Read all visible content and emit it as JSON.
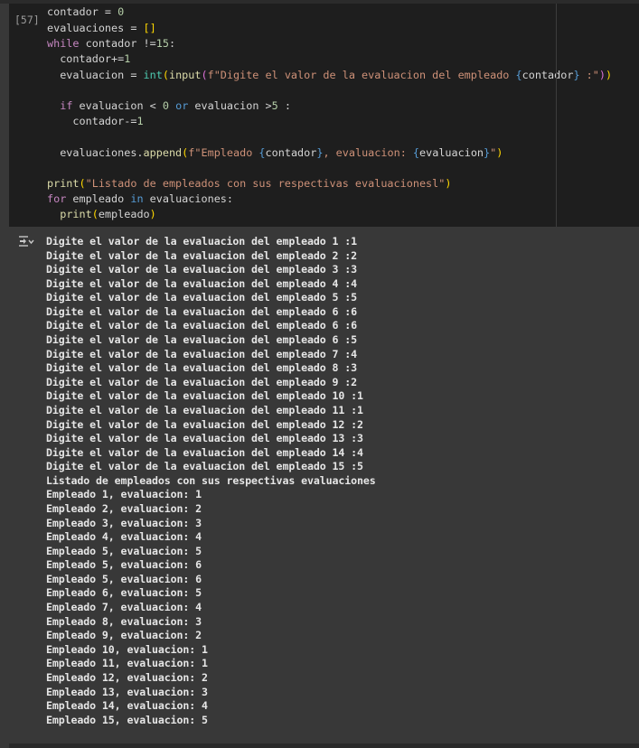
{
  "cell": {
    "execution_count": "[57]",
    "code_lines": [
      [
        {
          "t": "contador = ",
          "c": "txt"
        },
        {
          "t": "0",
          "c": "num"
        }
      ],
      [
        {
          "t": "evaluaciones = ",
          "c": "txt"
        },
        {
          "t": "[]",
          "c": "br"
        }
      ],
      [
        {
          "t": "while",
          "c": "kw"
        },
        {
          "t": " contador !=",
          "c": "txt"
        },
        {
          "t": "15",
          "c": "num"
        },
        {
          "t": ":",
          "c": "txt"
        }
      ],
      [
        {
          "t": "  contador+=",
          "c": "txt"
        },
        {
          "t": "1",
          "c": "num"
        }
      ],
      [
        {
          "t": "  evaluacion = ",
          "c": "txt"
        },
        {
          "t": "int",
          "c": "bi"
        },
        {
          "t": "(",
          "c": "br"
        },
        {
          "t": "input",
          "c": "fn"
        },
        {
          "t": "(",
          "c": "br2"
        },
        {
          "t": "f\"Digite el valor de la evaluacion del empleado ",
          "c": "str"
        },
        {
          "t": "{",
          "c": "ctl"
        },
        {
          "t": "contador",
          "c": "txt"
        },
        {
          "t": "}",
          "c": "ctl"
        },
        {
          "t": " :\"",
          "c": "str"
        },
        {
          "t": ")",
          "c": "br2"
        },
        {
          "t": ")",
          "c": "br"
        }
      ],
      [],
      [
        {
          "t": "  ",
          "c": "txt"
        },
        {
          "t": "if",
          "c": "kw"
        },
        {
          "t": " evaluacion < ",
          "c": "txt"
        },
        {
          "t": "0",
          "c": "num"
        },
        {
          "t": " ",
          "c": "txt"
        },
        {
          "t": "or",
          "c": "ctl"
        },
        {
          "t": " evaluacion >",
          "c": "txt"
        },
        {
          "t": "5",
          "c": "num"
        },
        {
          "t": " :",
          "c": "txt"
        }
      ],
      [
        {
          "t": "    contador-=",
          "c": "txt"
        },
        {
          "t": "1",
          "c": "num"
        }
      ],
      [],
      [
        {
          "t": "  evaluaciones.",
          "c": "txt"
        },
        {
          "t": "append",
          "c": "fn"
        },
        {
          "t": "(",
          "c": "br"
        },
        {
          "t": "f\"Empleado ",
          "c": "str"
        },
        {
          "t": "{",
          "c": "ctl"
        },
        {
          "t": "contador",
          "c": "txt"
        },
        {
          "t": "}",
          "c": "ctl"
        },
        {
          "t": ", evaluacion: ",
          "c": "str"
        },
        {
          "t": "{",
          "c": "ctl"
        },
        {
          "t": "evaluacion",
          "c": "txt"
        },
        {
          "t": "}",
          "c": "ctl"
        },
        {
          "t": "\"",
          "c": "str"
        },
        {
          "t": ")",
          "c": "br"
        }
      ],
      [],
      [
        {
          "t": "print",
          "c": "fn"
        },
        {
          "t": "(",
          "c": "br"
        },
        {
          "t": "\"Listado de empleados con sus respectivas evaluacionesl\"",
          "c": "str"
        },
        {
          "t": ")",
          "c": "br"
        }
      ],
      [
        {
          "t": "for",
          "c": "kw"
        },
        {
          "t": " empleado ",
          "c": "txt"
        },
        {
          "t": "in",
          "c": "ctl"
        },
        {
          "t": " evaluaciones:",
          "c": "txt"
        }
      ],
      [
        {
          "t": "  ",
          "c": "txt"
        },
        {
          "t": "print",
          "c": "fn"
        },
        {
          "t": "(",
          "c": "br"
        },
        {
          "t": "empleado",
          "c": "txt"
        },
        {
          "t": ")",
          "c": "br"
        }
      ]
    ]
  },
  "output": {
    "icon": "output-toggle-icon",
    "lines": [
      "Digite el valor de la evaluacion del empleado 1 :1",
      "Digite el valor de la evaluacion del empleado 2 :2",
      "Digite el valor de la evaluacion del empleado 3 :3",
      "Digite el valor de la evaluacion del empleado 4 :4",
      "Digite el valor de la evaluacion del empleado 5 :5",
      "Digite el valor de la evaluacion del empleado 6 :6",
      "Digite el valor de la evaluacion del empleado 6 :6",
      "Digite el valor de la evaluacion del empleado 6 :5",
      "Digite el valor de la evaluacion del empleado 7 :4",
      "Digite el valor de la evaluacion del empleado 8 :3",
      "Digite el valor de la evaluacion del empleado 9 :2",
      "Digite el valor de la evaluacion del empleado 10 :1",
      "Digite el valor de la evaluacion del empleado 11 :1",
      "Digite el valor de la evaluacion del empleado 12 :2",
      "Digite el valor de la evaluacion del empleado 13 :3",
      "Digite el valor de la evaluacion del empleado 14 :4",
      "Digite el valor de la evaluacion del empleado 15 :5",
      "Listado de empleados con sus respectivas evaluaciones",
      "Empleado 1, evaluacion: 1",
      "Empleado 2, evaluacion: 2",
      "Empleado 3, evaluacion: 3",
      "Empleado 4, evaluacion: 4",
      "Empleado 5, evaluacion: 5",
      "Empleado 5, evaluacion: 6",
      "Empleado 5, evaluacion: 6",
      "Empleado 6, evaluacion: 5",
      "Empleado 7, evaluacion: 4",
      "Empleado 8, evaluacion: 3",
      "Empleado 9, evaluacion: 2",
      "Empleado 10, evaluacion: 1",
      "Empleado 11, evaluacion: 1",
      "Empleado 12, evaluacion: 2",
      "Empleado 13, evaluacion: 3",
      "Empleado 14, evaluacion: 4",
      "Empleado 15, evaluacion: 5"
    ]
  }
}
